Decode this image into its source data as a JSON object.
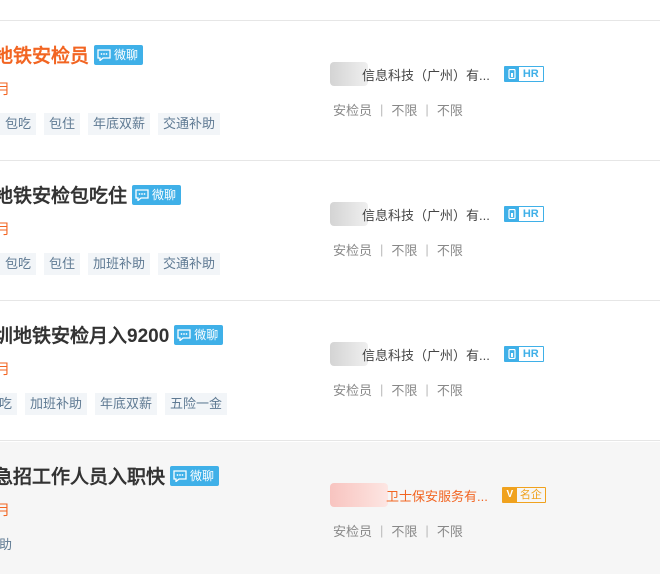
{
  "jobs": [
    {
      "title": "地铁安检员",
      "title_color": "#f26522",
      "chat_badge": "微聊",
      "salary": "月",
      "tags": [
        "包吃",
        "包住",
        "年底双薪",
        "交通补助"
      ],
      "company": "信息科技（广州）有...",
      "badge": {
        "icon": "hr-icon",
        "text": "HR"
      },
      "requirements": [
        "安检员",
        "不限",
        "不限"
      ]
    },
    {
      "title": "地铁安检包吃住",
      "chat_badge": "微聊",
      "salary": "月",
      "tags": [
        "包吃",
        "包住",
        "加班补助",
        "交通补助"
      ],
      "company": "信息科技（广州）有...",
      "badge": {
        "icon": "hr-icon",
        "text": "HR"
      },
      "requirements": [
        "安检员",
        "不限",
        "不限"
      ]
    },
    {
      "title": "圳地铁安检月入9200",
      "chat_badge": "微聊",
      "salary": "月",
      "tags": [
        "吃",
        "加班补助",
        "年底双薪",
        "五险一金"
      ],
      "company": "信息科技（广州）有...",
      "badge": {
        "icon": "hr-icon",
        "text": "HR"
      },
      "requirements": [
        "安检员",
        "不限",
        "不限"
      ]
    },
    {
      "title": "急招工作人员入职快",
      "chat_badge": "微聊",
      "salary": "月",
      "tags": [
        "助"
      ],
      "company": "卫士保安服务有...",
      "badge": {
        "icon": "v-icon",
        "text": "名企",
        "color": "#f0a21e"
      },
      "requirements": [
        "安检员",
        "不限",
        "不限"
      ]
    }
  ],
  "colors": {
    "accent": "#f26522",
    "chat": "#3fb0e8",
    "tag_text": "#5f7a93"
  }
}
